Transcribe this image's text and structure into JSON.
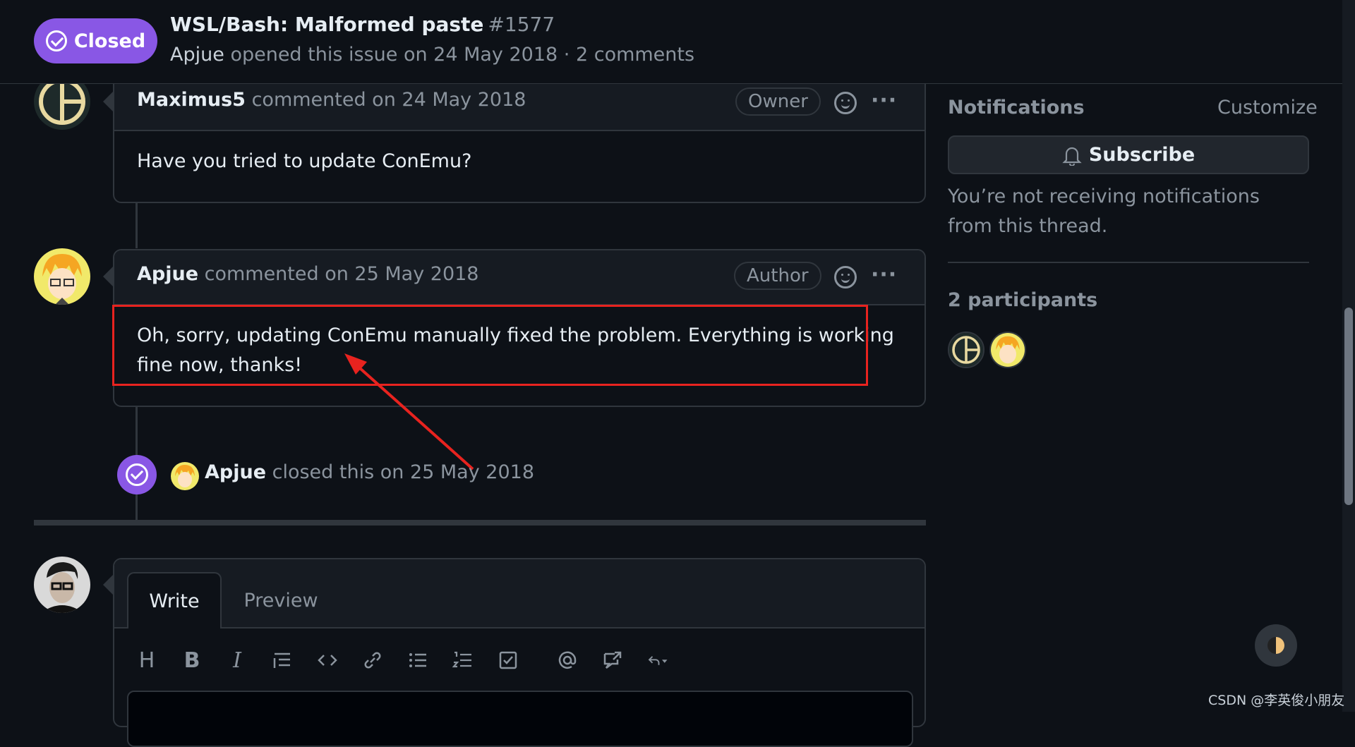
{
  "issue": {
    "state": "Closed",
    "title": "WSL/Bash: Malformed paste",
    "number": "#1577",
    "meta_author": "Apjue",
    "meta_rest": "opened this issue on 24 May 2018 · 2 comments"
  },
  "comments": [
    {
      "author": "Maximus5",
      "action": "commented on 24 May 2018",
      "role": "Owner",
      "body": "Have you tried to update ConEmu?"
    },
    {
      "author": "Apjue",
      "action": "commented on 25 May 2018",
      "role": "Author",
      "body": "Oh, sorry, updating ConEmu manually fixed the problem. Everything is working fine now, thanks!"
    }
  ],
  "event": {
    "actor": "Apjue",
    "text": "closed this on 25 May 2018"
  },
  "editor": {
    "tab_write": "Write",
    "tab_preview": "Preview",
    "tools": [
      "H",
      "B",
      "I"
    ]
  },
  "sidebar": {
    "notifications_heading": "Notifications",
    "customize": "Customize",
    "subscribe": "Subscribe",
    "note": "You’re not receiving notifications from this thread.",
    "participants_heading": "2 participants"
  },
  "watermark": "CSDN @李英俊小朋友",
  "colors": {
    "background": "#0d1117",
    "closed_purple": "#8957e5",
    "border": "#30363d",
    "annotation_red": "#e8231f"
  }
}
